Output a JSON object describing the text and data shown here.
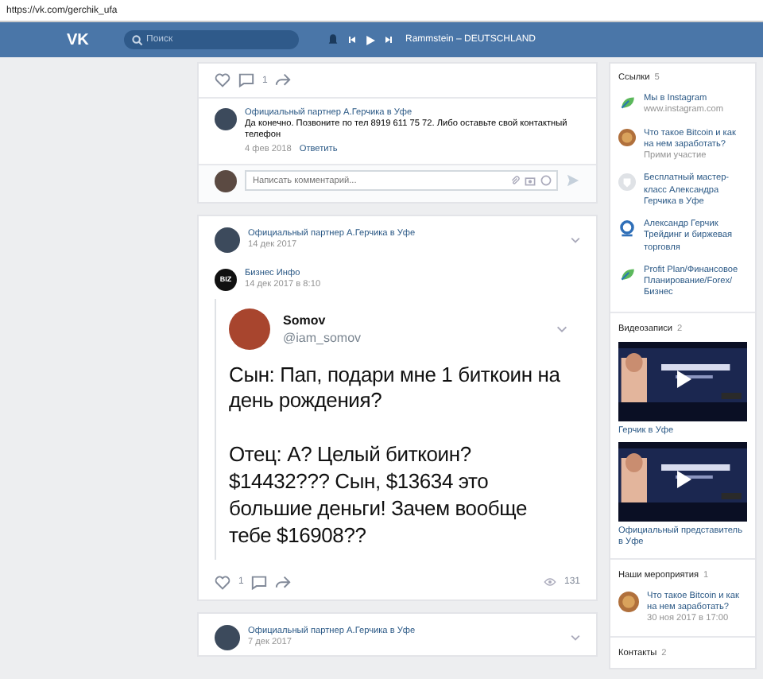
{
  "browser": {
    "url": "https://vk.com/gerchik_ufa"
  },
  "header": {
    "logo": "VK",
    "search": {
      "placeholder": "Поиск"
    },
    "player": {
      "track": "Rammstein – DEUTSCHLAND"
    }
  },
  "post_1": {
    "actions": {
      "comments": "1"
    },
    "comment": {
      "author": "Официальный партнер А.Герчика в Уфе",
      "text": "Да конечно. Позвоните по тел 8919 611 75 72. Либо оставьте свой контактный телефон",
      "date": "4 фев 2018",
      "reply": "Ответить"
    },
    "comment_field": {
      "placeholder": "Написать комментарий..."
    }
  },
  "post_2": {
    "author": "Официальный партнер А.Герчика в Уфе",
    "date": "14 дек 2017",
    "repost": {
      "author": "Бизнес Инфо",
      "avatar": "BIZ",
      "date": "14 дек 2017 в 8:10",
      "tweet": {
        "name": "Somov",
        "handle": "@iam_somov",
        "text": "Сын: Пап, подари мне 1 биткоин на день рождения?\n\nОтец: А? Целый биткоин? $14432??? Сын, $13634 это большие деньги! Зачем вообще тебе $16908??"
      }
    },
    "actions": {
      "likes": "1",
      "views": "131"
    }
  },
  "post_3": {
    "author": "Официальный партнер А.Герчика в Уфе",
    "date": "7 дек 2017"
  },
  "sidebar": {
    "links": {
      "title": "Ссылки",
      "count": "5",
      "items": [
        {
          "kind": "leaf",
          "title": "Мы в Instagram",
          "subtitle": "www.instagram.com"
        },
        {
          "kind": "coin",
          "title": "Что такое Bitcoin и как на нем заработать?",
          "subtitle": "Прими участие"
        },
        {
          "kind": "shield",
          "title": "Бесплатный мастер-класс Александра Герчика в Уфе"
        },
        {
          "kind": "ring",
          "title": "Александр Герчик Трейдинг и биржевая торговля"
        },
        {
          "kind": "leaf",
          "title": "Profit Plan/Финансовое Планирование/Forex/Бизнес"
        }
      ]
    },
    "videos": {
      "title": "Видеозаписи",
      "count": "2",
      "items": [
        {
          "caption": "Герчик в Уфе"
        },
        {
          "caption": "Официальный представитель в Уфе"
        }
      ]
    },
    "events": {
      "title": "Наши мероприятия",
      "count": "1",
      "items": [
        {
          "title": "Что такое Bitcoin и как на нем заработать?",
          "date": "30 ноя 2017 в 17:00"
        }
      ]
    },
    "contacts": {
      "title": "Контакты",
      "count": "2"
    }
  }
}
